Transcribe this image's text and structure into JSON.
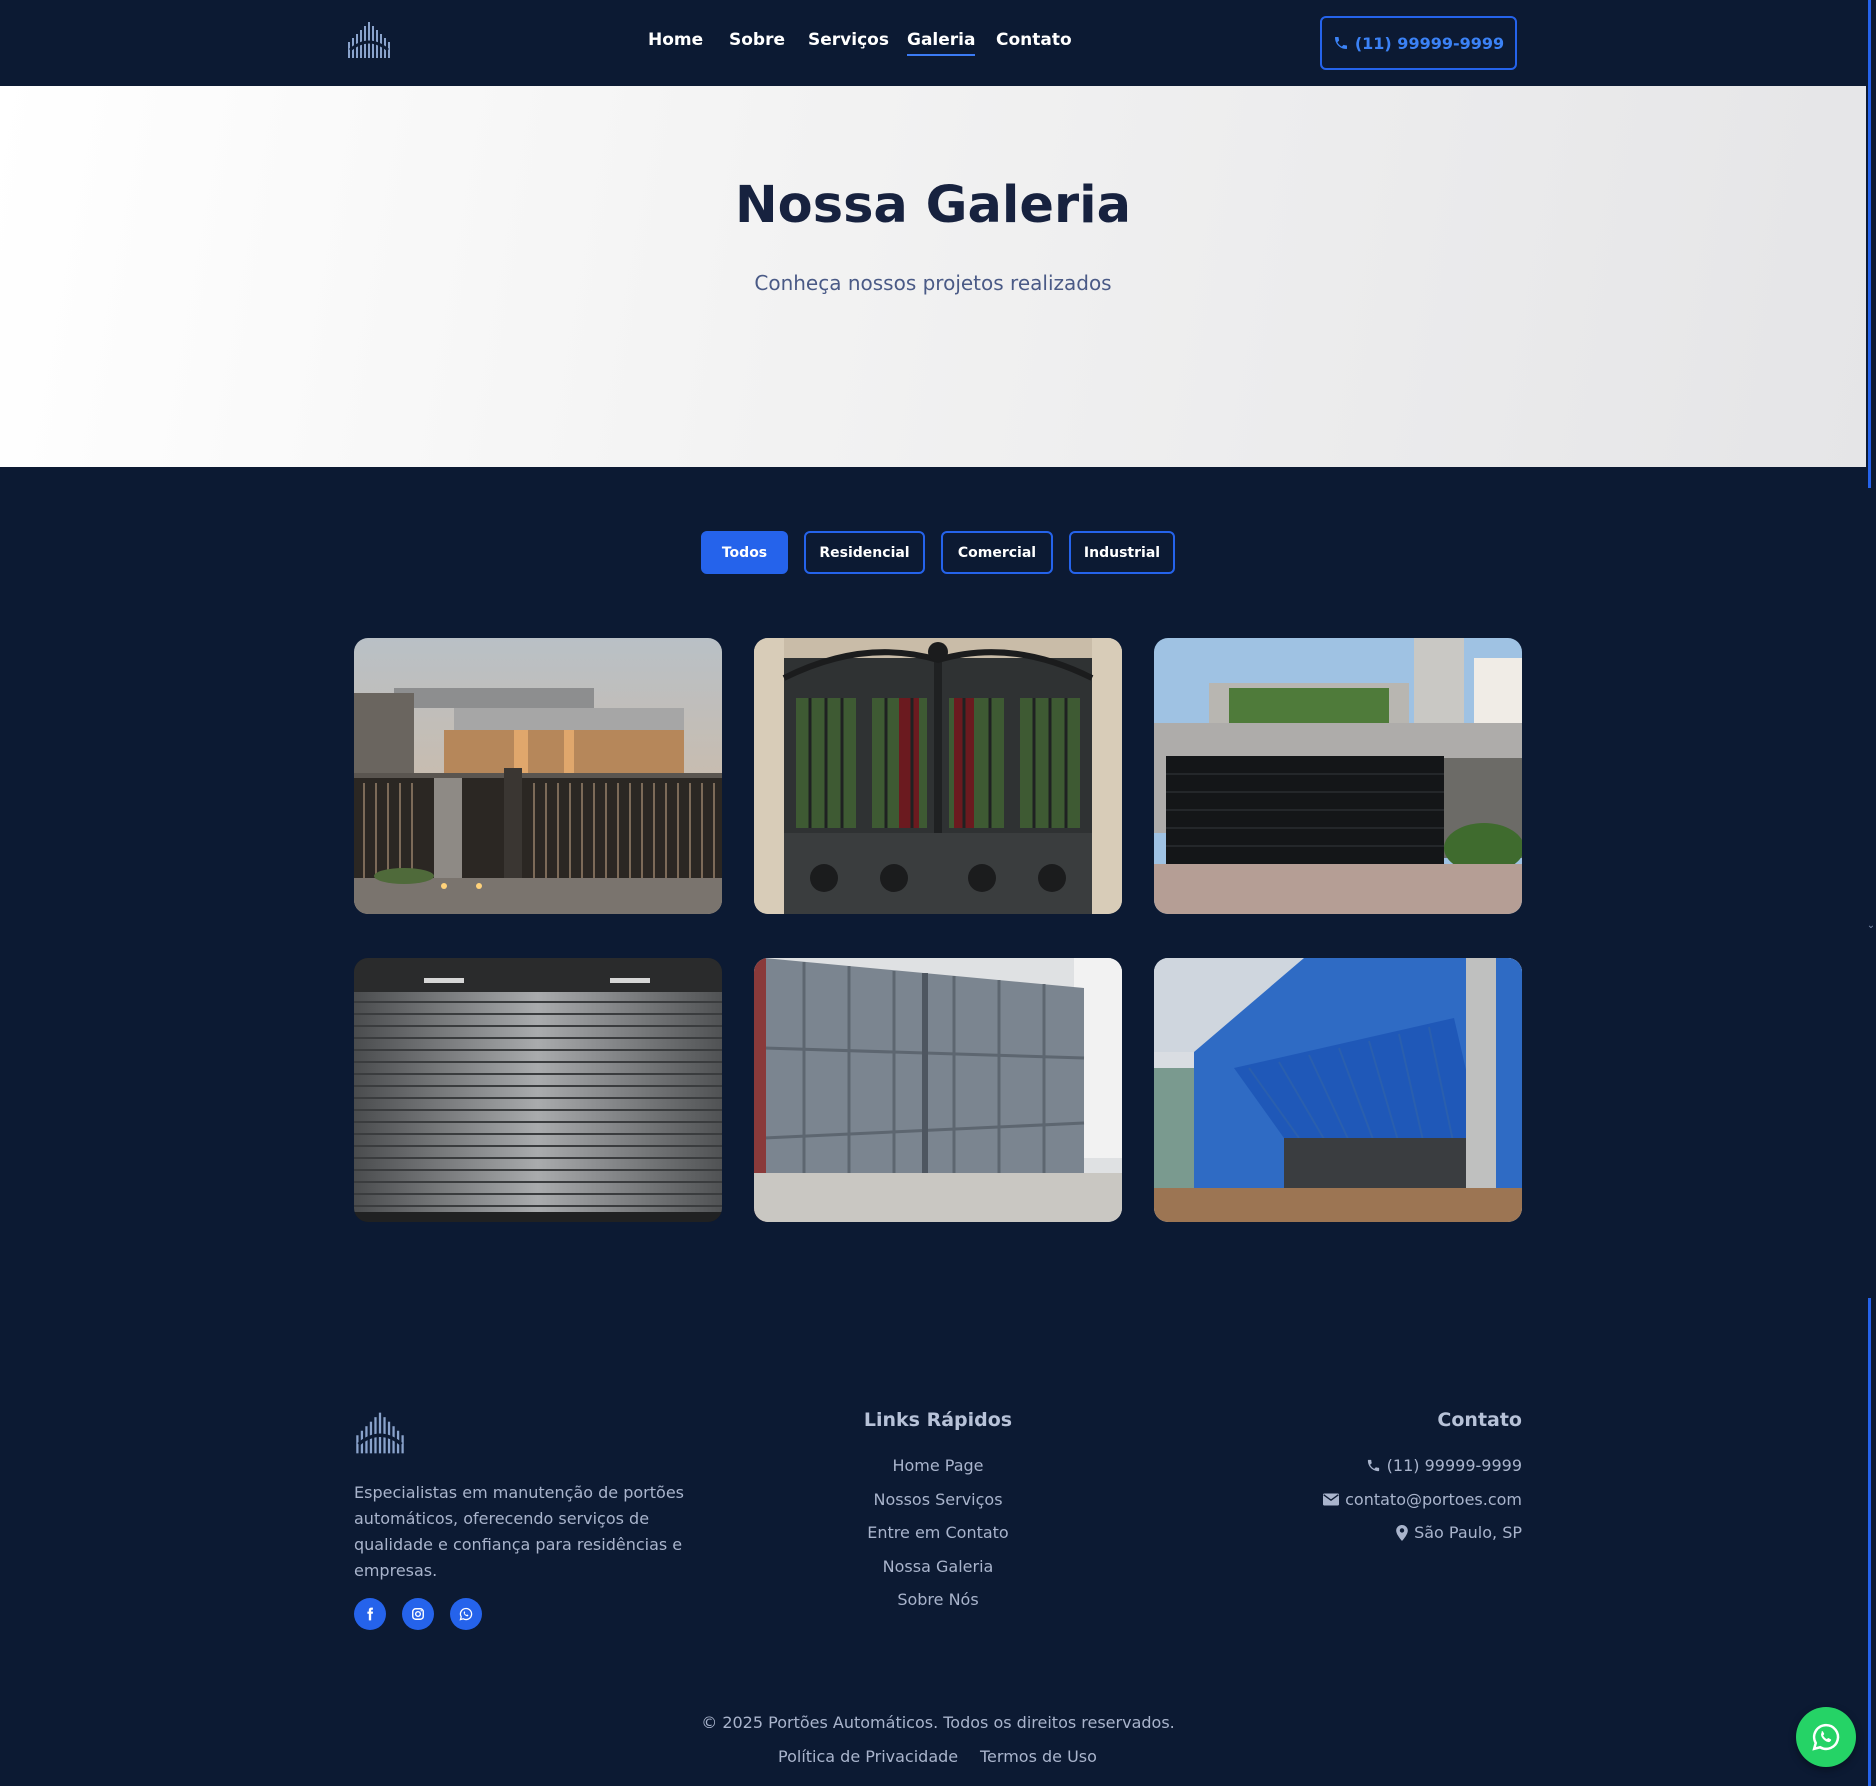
{
  "header": {
    "nav": [
      {
        "label": "Home"
      },
      {
        "label": "Sobre"
      },
      {
        "label": "Serviços"
      },
      {
        "label": "Galeria"
      },
      {
        "label": "Contato"
      }
    ],
    "active_nav": "Galeria",
    "phone_button": "(11) 99999-9999"
  },
  "hero": {
    "title": "Nossa Galeria",
    "subtitle": "Conheça nossos projetos realizados"
  },
  "filters": {
    "items": [
      "Todos",
      "Residencial",
      "Comercial",
      "Industrial"
    ],
    "active": "Todos"
  },
  "gallery": {
    "items": [
      {
        "icon": "modern-house-sliding-gate-photo"
      },
      {
        "icon": "ornate-wrought-iron-gate-photo"
      },
      {
        "icon": "black-sectional-garage-door-photo"
      },
      {
        "icon": "rolling-steel-shutter-photo"
      },
      {
        "icon": "grey-metal-swing-gate-photo"
      },
      {
        "icon": "blue-industrial-tilt-door-photo"
      }
    ]
  },
  "footer": {
    "description": "Especialistas em manutenção de portões automáticos, oferecendo serviços de qualidade e confiança para residências e empresas.",
    "links_title": "Links Rápidos",
    "links": [
      "Home Page",
      "Nossos Serviços",
      "Entre em Contato",
      "Nossa Galeria",
      "Sobre Nós"
    ],
    "contact_title": "Contato",
    "contact": {
      "phone": "(11) 99999-9999",
      "email": "contato@portoes.com",
      "location": "São Paulo, SP"
    },
    "copyright": "© 2025 Portões Automáticos. Todos os direitos reservados.",
    "privacy": "Política de Privacidade",
    "terms": "Termos de Uso"
  },
  "colors": {
    "background": "#0c1a33",
    "accent": "#2563eb",
    "whatsapp": "#25d366"
  }
}
